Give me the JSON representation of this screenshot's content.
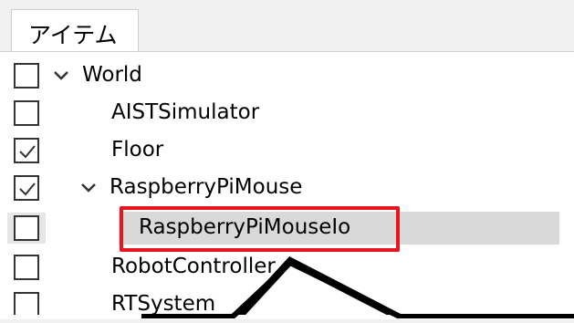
{
  "tab": {
    "label": "アイテム"
  },
  "tree": [
    {
      "label": "World",
      "checked": false,
      "expanded": true
    },
    {
      "label": "AISTSimulator",
      "checked": false
    },
    {
      "label": "Floor",
      "checked": true
    },
    {
      "label": "RaspberryPiMouse",
      "checked": true,
      "expanded": true
    },
    {
      "label": "RaspberryPiMouseIo",
      "checked": false,
      "selected": true
    },
    {
      "label": "RobotController",
      "checked": false
    },
    {
      "label": "RTSystem",
      "checked": false
    }
  ],
  "colors": {
    "highlight": "#e8141f",
    "selection": "#d9d9d9"
  },
  "icons": {
    "expanded": "chevron-down-icon",
    "checked": "checkmark-icon"
  }
}
